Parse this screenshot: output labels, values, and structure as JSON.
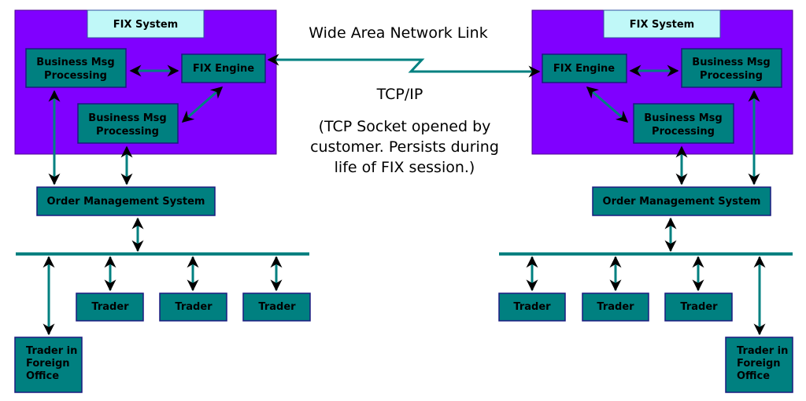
{
  "colors": {
    "system": "#8000ff",
    "box": "#008080",
    "label": "#c0f8f8",
    "link": "#008080"
  },
  "left": {
    "system_label": "FIX System",
    "bmp1": [
      "Business Msg",
      "Processing"
    ],
    "engine": "FIX Engine",
    "bmp2": [
      "Business Msg",
      "Processing"
    ],
    "oms": "Order Management System",
    "traders": [
      "Trader",
      "Trader",
      "Trader"
    ],
    "foreign": [
      "Trader in",
      "Foreign",
      "Office"
    ]
  },
  "right": {
    "system_label": "FIX System",
    "bmp1": [
      "Business Msg",
      "Processing"
    ],
    "engine": "FIX Engine",
    "bmp2": [
      "Business Msg",
      "Processing"
    ],
    "oms": "Order Management System",
    "traders": [
      "Trader",
      "Trader",
      "Trader"
    ],
    "foreign": [
      "Trader in",
      "Foreign",
      "Office"
    ]
  },
  "link": {
    "title": "Wide Area Network Link",
    "protocol": "TCP/IP",
    "note": [
      "(TCP Socket opened by",
      "customer. Persists during",
      "life of FIX session.)"
    ]
  }
}
